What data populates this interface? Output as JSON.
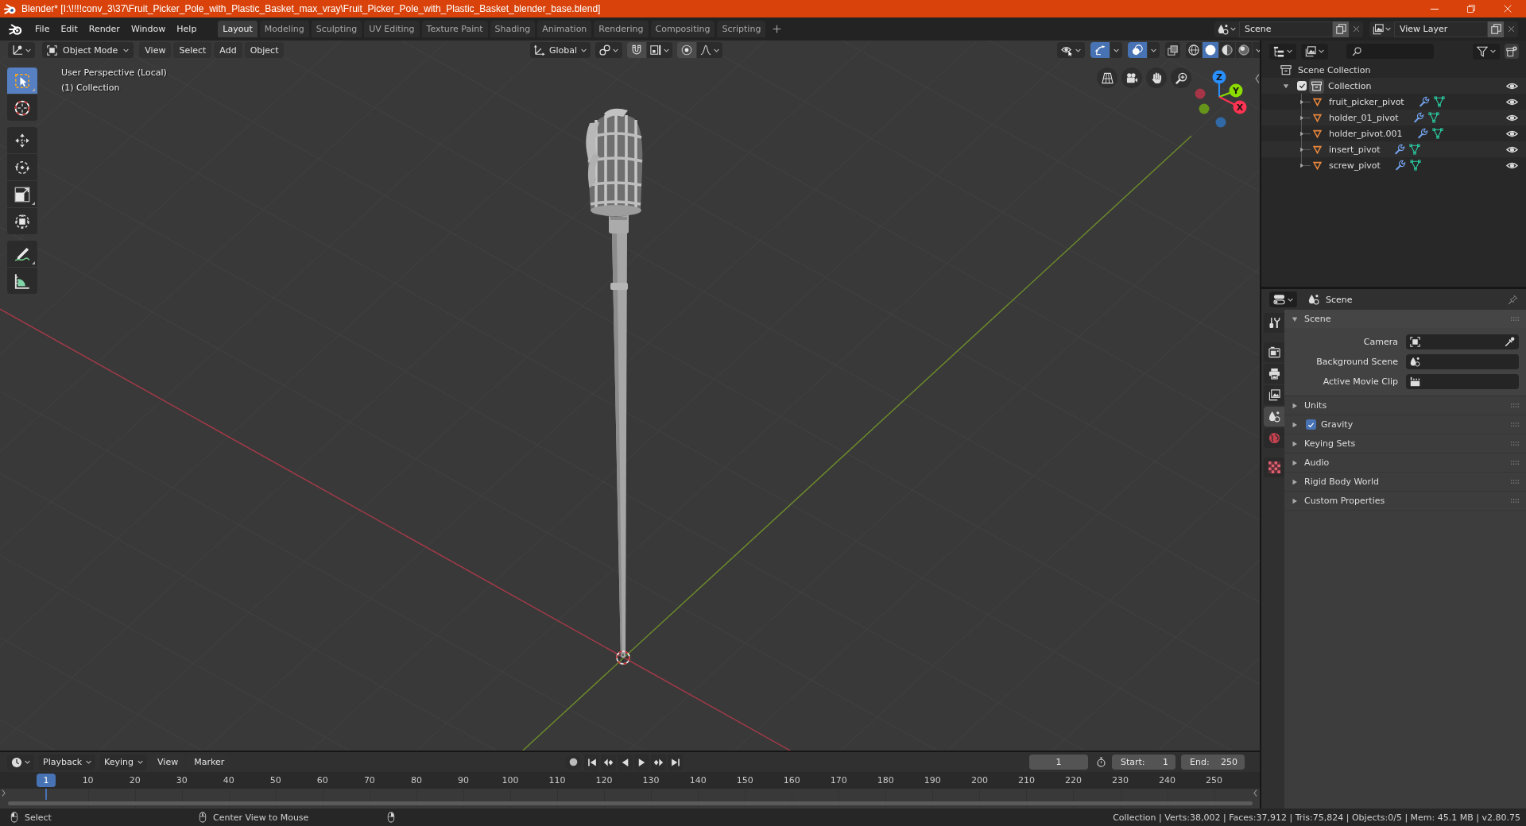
{
  "window": {
    "title": "Blender* [I:\\!!!!conv_3\\37\\Fruit_Picker_Pole_with_Plastic_Basket_max_vray\\Fruit_Picker_Pole_with_Plastic_Basket_blender_base.blend]"
  },
  "top_bar": {
    "menus": [
      "File",
      "Edit",
      "Render",
      "Window",
      "Help"
    ],
    "workspace_tabs": [
      {
        "label": "Layout",
        "selected": true
      },
      {
        "label": "Modeling",
        "selected": false
      },
      {
        "label": "Sculpting",
        "selected": false
      },
      {
        "label": "UV Editing",
        "selected": false
      },
      {
        "label": "Texture Paint",
        "selected": false
      },
      {
        "label": "Shading",
        "selected": false
      },
      {
        "label": "Animation",
        "selected": false
      },
      {
        "label": "Rendering",
        "selected": false
      },
      {
        "label": "Compositing",
        "selected": false
      },
      {
        "label": "Scripting",
        "selected": false
      }
    ],
    "scene": "Scene",
    "view_layer": "View Layer"
  },
  "viewport": {
    "header": {
      "mode": "Object Mode",
      "menus": [
        "View",
        "Select",
        "Add",
        "Object"
      ],
      "orientation": "Global",
      "show_gizmos": true,
      "show_overlays": true,
      "shading_modes": [
        {
          "kind": "wireframe",
          "selected": false
        },
        {
          "kind": "solid",
          "selected": true
        },
        {
          "kind": "material",
          "selected": false
        },
        {
          "kind": "rendered",
          "selected": false
        }
      ]
    },
    "info": [
      "User Perspective (Local)",
      "(1) Collection"
    ],
    "tool_groups": [
      [
        {
          "kind": "select",
          "selected": true,
          "variants": true
        },
        {
          "kind": "cursor",
          "selected": false,
          "variants": false
        }
      ],
      [
        {
          "kind": "move",
          "selected": false,
          "variants": false
        },
        {
          "kind": "rotate",
          "selected": false,
          "variants": false
        },
        {
          "kind": "scale",
          "selected": false,
          "variants": true
        },
        {
          "kind": "transform",
          "selected": false,
          "variants": false
        }
      ],
      [
        {
          "kind": "annotate",
          "selected": false,
          "variants": true
        },
        {
          "kind": "measure",
          "selected": false,
          "variants": false
        }
      ]
    ],
    "gizmo_axes": [
      {
        "label": "X",
        "color": "#ff3352"
      },
      {
        "label": "Y",
        "color": "#8bdc00"
      },
      {
        "label": "Z",
        "color": "#2890ff"
      }
    ]
  },
  "outliner": {
    "root": "Scene Collection",
    "collections": [
      {
        "label": "Collection",
        "checked": true,
        "expanded": true,
        "visible": true,
        "children": [
          {
            "label": "fruit_picker_pivot",
            "expanded": false,
            "visible": true
          },
          {
            "label": "holder_01_pivot",
            "expanded": false,
            "visible": true
          },
          {
            "label": "holder_pivot.001",
            "expanded": false,
            "visible": true
          },
          {
            "label": "insert_pivot",
            "expanded": false,
            "visible": true
          },
          {
            "label": "screw_pivot",
            "expanded": false,
            "visible": true
          }
        ]
      }
    ]
  },
  "properties": {
    "context": "Scene",
    "tab_groups": [
      [
        {
          "kind": "tool",
          "selected": false
        }
      ],
      [
        {
          "kind": "render",
          "selected": false
        },
        {
          "kind": "output",
          "selected": false
        },
        {
          "kind": "view_layer",
          "selected": false
        },
        {
          "kind": "scene",
          "selected": true
        },
        {
          "kind": "world",
          "selected": false
        }
      ],
      [
        {
          "kind": "texture",
          "selected": false
        }
      ]
    ],
    "panels": [
      {
        "label": "Scene",
        "kind": "plain",
        "expanded": true,
        "fields": [
          {
            "label": "Camera",
            "kind": "camera"
          },
          {
            "label": "Background Scene",
            "kind": "scene"
          },
          {
            "label": "Active Movie Clip",
            "kind": "clip"
          }
        ]
      },
      {
        "label": "Units",
        "kind": "plain",
        "expanded": false
      },
      {
        "label": "Gravity",
        "kind": "toggle",
        "checked": true,
        "expanded": false
      },
      {
        "label": "Keying Sets",
        "kind": "plain",
        "expanded": false
      },
      {
        "label": "Audio",
        "kind": "plain",
        "expanded": false
      },
      {
        "label": "Rigid Body World",
        "kind": "plain",
        "expanded": false
      },
      {
        "label": "Custom Properties",
        "kind": "plain",
        "expanded": false
      }
    ]
  },
  "timeline": {
    "menus": [
      {
        "label": "Playback",
        "kind": "dropdown"
      },
      {
        "label": "Keying",
        "kind": "dropdown"
      },
      {
        "label": "View",
        "kind": "menu"
      },
      {
        "label": "Marker",
        "kind": "menu"
      }
    ],
    "current_frame": "1",
    "start": {
      "label": "Start:",
      "value": "1"
    },
    "end": {
      "label": "End:",
      "value": "250"
    },
    "playhead": "1",
    "ruler": [
      "10",
      "20",
      "30",
      "40",
      "50",
      "60",
      "70",
      "80",
      "90",
      "100",
      "110",
      "120",
      "130",
      "140",
      "150",
      "160",
      "170",
      "180",
      "190",
      "200",
      "210",
      "220",
      "230",
      "240",
      "250"
    ]
  },
  "status_bar": {
    "hints": [
      {
        "kind": "left",
        "label": "Select"
      },
      {
        "kind": "middle",
        "label": "Center View to Mouse"
      },
      {
        "kind": "right"
      }
    ],
    "stats": "Collection | Verts:38,002 | Faces:37,912 | Tris:75,824 | Objects:0/5 | Mem: 45.1 MB | v2.80.75"
  }
}
